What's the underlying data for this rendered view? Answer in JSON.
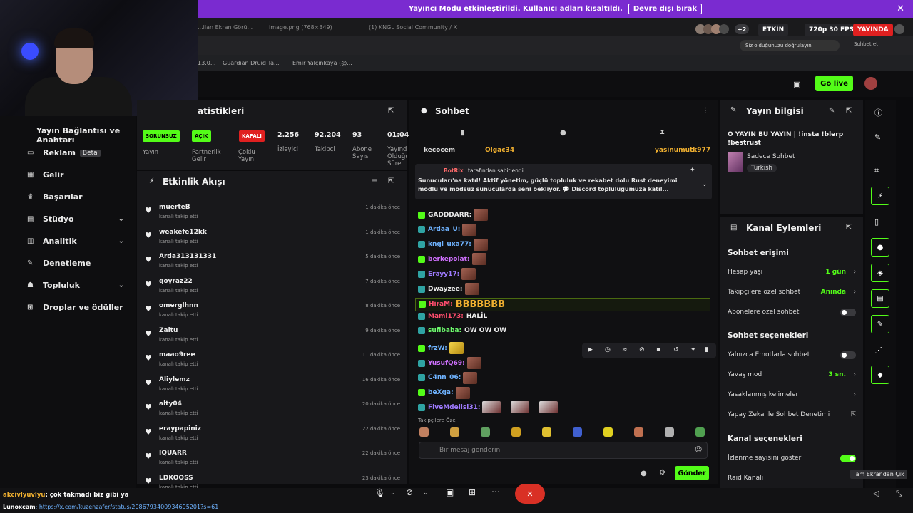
{
  "banner": {
    "text": "Yayıncı Modu etkinleştirildi. Kullanıcı adları kısaltıldı.",
    "button": "Devre dışı bırak"
  },
  "status": {
    "count": "+2",
    "etkin": "ETKİN",
    "quality": "720p 30 FPS",
    "live": "YAYINDA"
  },
  "browser": {
    "tab1": "...ilan Ekran Görü...",
    "tab2": "image.png (768×349)",
    "tab3": "(1) KNGL Social Community / X",
    "verify": "Siz olduğunuzu doğrulayın",
    "chat_right": "Sohbet et",
    "bookmark0": "13.0...",
    "bookmark1": "Guardian Druid Ta...",
    "bookmark2": "Emir Yalçınkaya (@..."
  },
  "header": {
    "go_live": "Go live"
  },
  "sidebar": {
    "title": "Yayın Bağlantısı ve Anahtarı",
    "items": [
      {
        "label": "Reklam",
        "badge": "Beta"
      },
      {
        "label": "Gelir"
      },
      {
        "label": "Başarılar"
      },
      {
        "label": "Stüdyo"
      },
      {
        "label": "Analitik"
      },
      {
        "label": "Denetleme"
      },
      {
        "label": "Topluluk"
      },
      {
        "label": "Droplar ve ödüller"
      }
    ]
  },
  "stats": {
    "title": "atistikleri",
    "pills": [
      "SORUNSUZ",
      "AÇIK",
      "KAPALI"
    ],
    "labels": [
      "Yayın",
      "Partnerlik Gelir",
      "Çoklu Yayın",
      "İzleyici",
      "Takipçi",
      "Abone Sayısı",
      "Yayında Olduğu Süre"
    ],
    "values": [
      "2.256",
      "92.204",
      "93",
      "01:04:"
    ]
  },
  "activity": {
    "title": "Etkinlik Akışı",
    "sub": "kanalı takip etti",
    "rows": [
      {
        "user": "muerteB",
        "time": "1 dakika önce"
      },
      {
        "user": "weakefe12kk",
        "time": "1 dakika önce"
      },
      {
        "user": "Arda313131331",
        "time": "5 dakika önce"
      },
      {
        "user": "qoyraz22",
        "time": "7 dakika önce"
      },
      {
        "user": "omerglhnn",
        "time": "8 dakika önce"
      },
      {
        "user": "Zaltu",
        "time": "9 dakika önce"
      },
      {
        "user": "maao9ree",
        "time": "11 dakika önce"
      },
      {
        "user": "Aliylemz",
        "time": "16 dakika önce"
      },
      {
        "user": "alty04",
        "time": "20 dakika önce"
      },
      {
        "user": "eraypapiniz",
        "time": "22 dakika önce"
      },
      {
        "user": "IQUARR",
        "time": "22 dakika önce"
      },
      {
        "user": "LDKOOSS",
        "time": "23 dakika önce"
      }
    ]
  },
  "chat": {
    "title": "Sohbet",
    "top_left_user": "kecocem",
    "top_left_user2": "Olgac34",
    "top_right_user": "yasinumutk977",
    "pinned_by": "BotRix",
    "pinned_suffix": "tarafından sabitlendi",
    "pinned_text": "Sunucuları'na katıl! Aktif yönetim, güçlü topluluk ve rekabet dolu Rust deneyimi modlu ve modsuz sunucularda seni bekliyor. 💬 Discord topluluğumuza katıl...",
    "messages": [
      {
        "user": "GADDDARR:",
        "color": "#e8e8e8"
      },
      {
        "user": "Ardaa_U:",
        "color": "#6fb3ff"
      },
      {
        "user": "kngl_uxa77:",
        "color": "#6fb3ff"
      },
      {
        "user": "berkepolat:",
        "color": "#d070ff"
      },
      {
        "user": "Erayy17:",
        "color": "#9f7bff"
      },
      {
        "user": "Dwayzee:",
        "color": "#e8e8e8"
      },
      {
        "user": "HiraM:",
        "color": "#ff4d6d",
        "text": "BBBBBBB"
      },
      {
        "user": "Mami173:",
        "color": "#ff4d6d",
        "text": "HALİL"
      },
      {
        "user": "sufibaba:",
        "color": "#6fff6f",
        "text": "OW OW OW"
      },
      {
        "user": "frzW:",
        "color": "#6fb3ff"
      },
      {
        "user": "YusufQ69:",
        "color": "#d070ff"
      },
      {
        "user": "C4nn_06:",
        "color": "#6fb3ff"
      },
      {
        "user": "beXga:",
        "color": "#6fb3ff"
      },
      {
        "user": "FiveMdelisi31:",
        "color": "#9f7bff"
      }
    ],
    "followers_only": "Takipçilere Özel",
    "input_placeholder": "Bir mesaj gönderin",
    "send": "Gönder"
  },
  "stream_info": {
    "title": "Yayın bilgisi",
    "stream_title": "O YAYIN BU YAYIN | !insta !blerp !bestrust",
    "category": "Sadece Sohbet",
    "tag": "Turkish"
  },
  "channel_actions": {
    "title": "Kanal Eylemleri",
    "chat_access": "Sohbet erişimi",
    "account_age": "Hesap yaşı",
    "account_age_val": "1 gün",
    "followers_chat": "Takipçilere özel sohbet",
    "followers_chat_val": "Anında",
    "subs_chat": "Abonelere özel sohbet",
    "chat_options": "Sohbet seçenekleri",
    "emote_only": "Yalnızca Emotlarla sohbet",
    "slow_mode": "Yavaş mod",
    "slow_mode_val": "3 sn.",
    "banned_words": "Yasaklanmış kelimeler",
    "ai_moderation": "Yapay Zeka ile Sohbet Denetimi",
    "channel_options": "Kanal seçenekleri",
    "show_viewers": "İzlenme sayısını göster",
    "raid": "Raid Kanalı"
  },
  "overlay": {
    "chat1_user": "akcivlyuvlyu",
    "chat1_text": ": çok takmadı biz gibi ya",
    "chat2_user": "Lunoxcam",
    "chat2_text": ": https://x.com/kuzenzafer/status/2086793400934695201?s=61",
    "fullscreen_tip": "Tam Ekrandan Çık"
  },
  "colors": {
    "accent": "#53fc18",
    "banner": "#7a2bd0",
    "live": "#e02020"
  }
}
